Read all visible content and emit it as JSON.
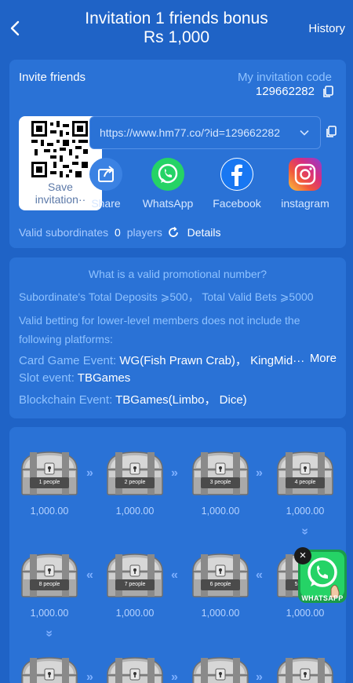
{
  "header": {
    "title_line1": "Invitation 1 friends bonus",
    "title_line2": "Rs 1,000",
    "history_label": "History"
  },
  "invite": {
    "invite_label": "Invite friends",
    "code_label": "My invitation code",
    "code_value": "129662282",
    "save_line1": "Save",
    "save_line2": "invitation··",
    "url": "https://www.hm77.co/?id=129662282"
  },
  "share": [
    {
      "label": "Share",
      "icon": "share-icon"
    },
    {
      "label": "WhatsApp",
      "icon": "whatsapp-icon"
    },
    {
      "label": "Facebook",
      "icon": "facebook-icon"
    },
    {
      "label": "instagram",
      "icon": "instagram-icon"
    }
  ],
  "valid": {
    "label": "Valid subordinates",
    "count": "0",
    "unit": "players",
    "details_label": "Details"
  },
  "rules": {
    "question": "What is a valid promotional number?",
    "deposits_line": "Subordinate's Total Deposits ⩾500， Total Valid Bets ⩾5000",
    "note_line1": "Valid betting for lower-level members does not include the",
    "note_line2": "following platforms:",
    "card_label": "Card Game Event:",
    "card_value": "WG(Fish Prawn Crab)， KingMid···",
    "more_label": "More",
    "slot_label": "Slot event:",
    "slot_value": "TBGames",
    "block_label": "Blockchain Event:",
    "block_value": "TBGames(Limbo， Dice)"
  },
  "rewards": [
    {
      "people": "1 people",
      "amount": "1,000.00"
    },
    {
      "people": "2 people",
      "amount": "1,000.00"
    },
    {
      "people": "3 people",
      "amount": "1,000.00"
    },
    {
      "people": "4 people",
      "amount": "1,000.00"
    },
    {
      "people": "5 people",
      "amount": "1,000.00"
    },
    {
      "people": "6 people",
      "amount": "1,000.00"
    },
    {
      "people": "7 people",
      "amount": "1,000.00"
    },
    {
      "people": "8 people",
      "amount": "1,000.00"
    }
  ],
  "floating": {
    "whatsapp_label": "WHATSAPP",
    "close_label": "×"
  },
  "colors": {
    "background": "#1f63c6",
    "card": "#2a72d6",
    "accent_text": "#8fc2ff",
    "whatsapp": "#25d366",
    "facebook": "#1877f2"
  }
}
